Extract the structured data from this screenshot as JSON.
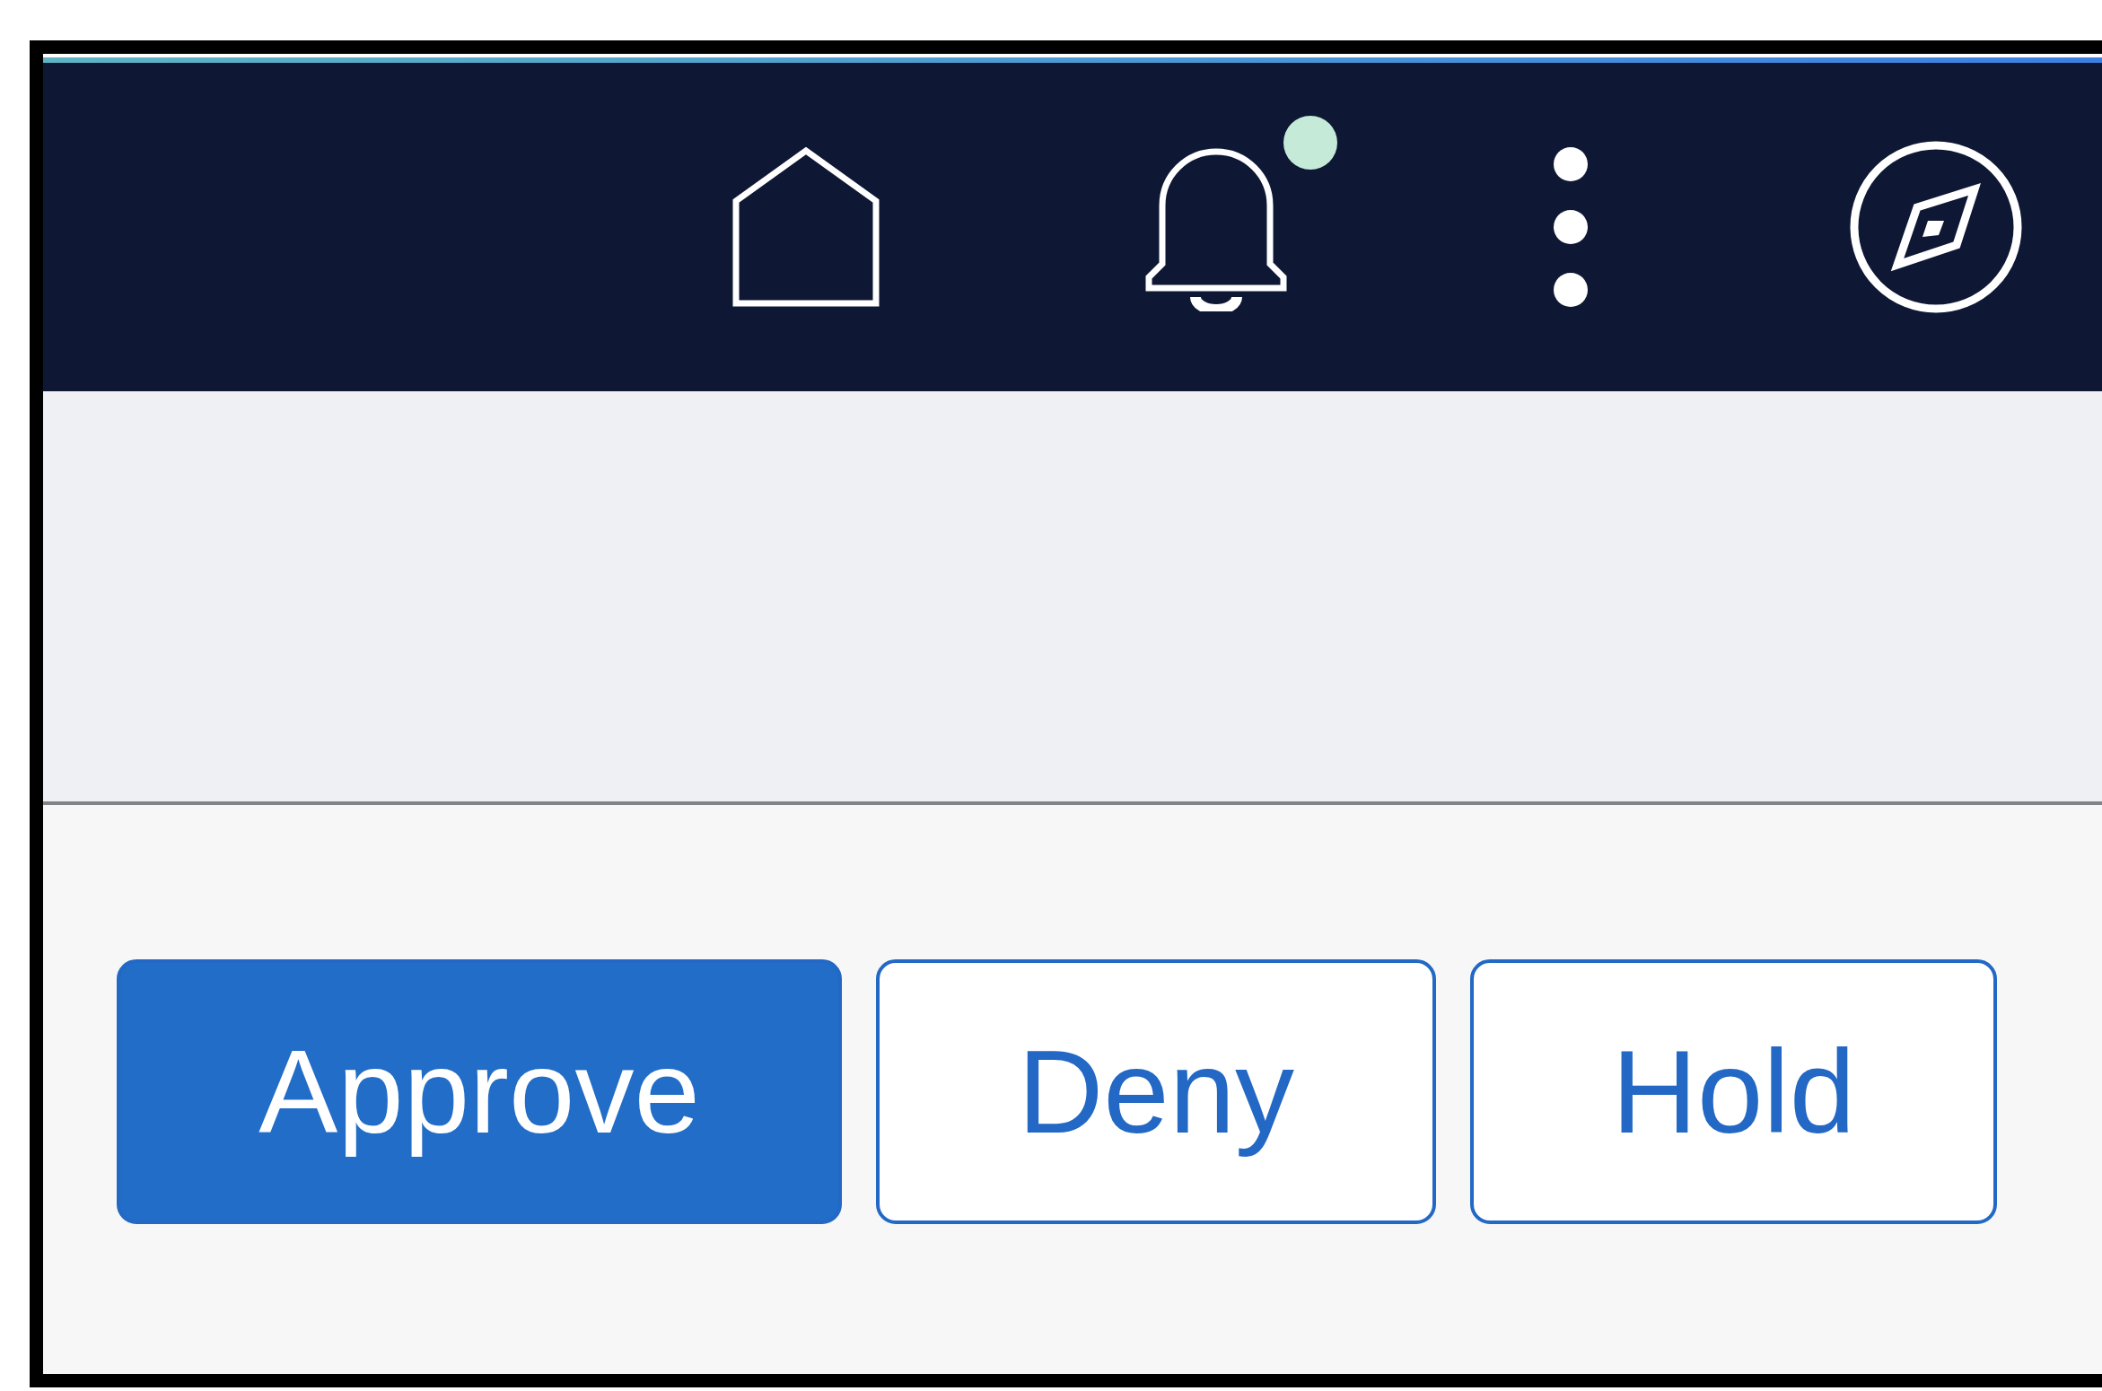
{
  "header": {
    "icons": [
      {
        "kind": "home"
      },
      {
        "kind": "bell",
        "notification": true
      },
      {
        "kind": "more"
      },
      {
        "kind": "compass"
      }
    ]
  },
  "actions": [
    {
      "label": "Approve",
      "kind": "primary"
    },
    {
      "label": "Deny",
      "kind": "secondary"
    },
    {
      "label": "Hold",
      "kind": "secondary"
    }
  ]
}
